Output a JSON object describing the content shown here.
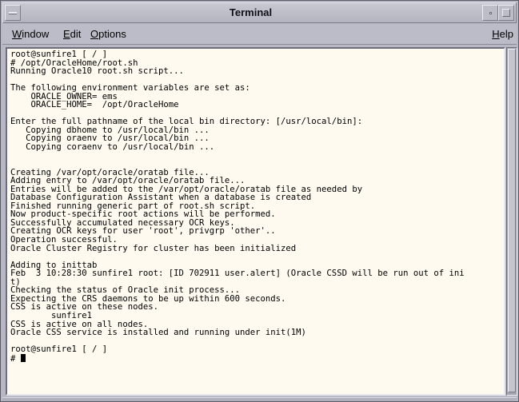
{
  "window": {
    "title": "Terminal"
  },
  "menubar": {
    "window_label": "Window",
    "window_mnemonic": "W",
    "window_rest": "indow",
    "edit_mnemonic": "E",
    "edit_rest": "dit",
    "options_mnemonic": "O",
    "options_rest": "ptions",
    "help_mnemonic": "H",
    "help_rest": "elp"
  },
  "terminal": {
    "lines": [
      "root@sunfire1 [ / ]",
      "# /opt/OracleHome/root.sh",
      "Running Oracle10 root.sh script...",
      "",
      "The following environment variables are set as:",
      "    ORACLE_OWNER= ems",
      "    ORACLE_HOME=  /opt/OracleHome",
      "",
      "Enter the full pathname of the local bin directory: [/usr/local/bin]:",
      "   Copying dbhome to /usr/local/bin ...",
      "   Copying oraenv to /usr/local/bin ...",
      "   Copying coraenv to /usr/local/bin ...",
      "",
      "",
      "Creating /var/opt/oracle/oratab file...",
      "Adding entry to /var/opt/oracle/oratab file...",
      "Entries will be added to the /var/opt/oracle/oratab file as needed by",
      "Database Configuration Assistant when a database is created",
      "Finished running generic part of root.sh script.",
      "Now product-specific root actions will be performed.",
      "Successfully accumulated necessary OCR keys.",
      "Creating OCR keys for user 'root', privgrp 'other'..",
      "Operation successful.",
      "Oracle Cluster Registry for cluster has been initialized",
      "",
      "Adding to inittab",
      "Feb  3 10:28:30 sunfire1 root: [ID 702911 user.alert] (Oracle CSSD will be run out of ini",
      "t)",
      "Checking the status of Oracle init process...",
      "Expecting the CRS daemons to be up within 600 seconds.",
      "CSS is active on these nodes.",
      "        sunfire1",
      "CSS is active on all nodes.",
      "Oracle CSS service is installed and running under init(1M)",
      "",
      "root@sunfire1 [ / ]"
    ],
    "prompt": "# "
  }
}
